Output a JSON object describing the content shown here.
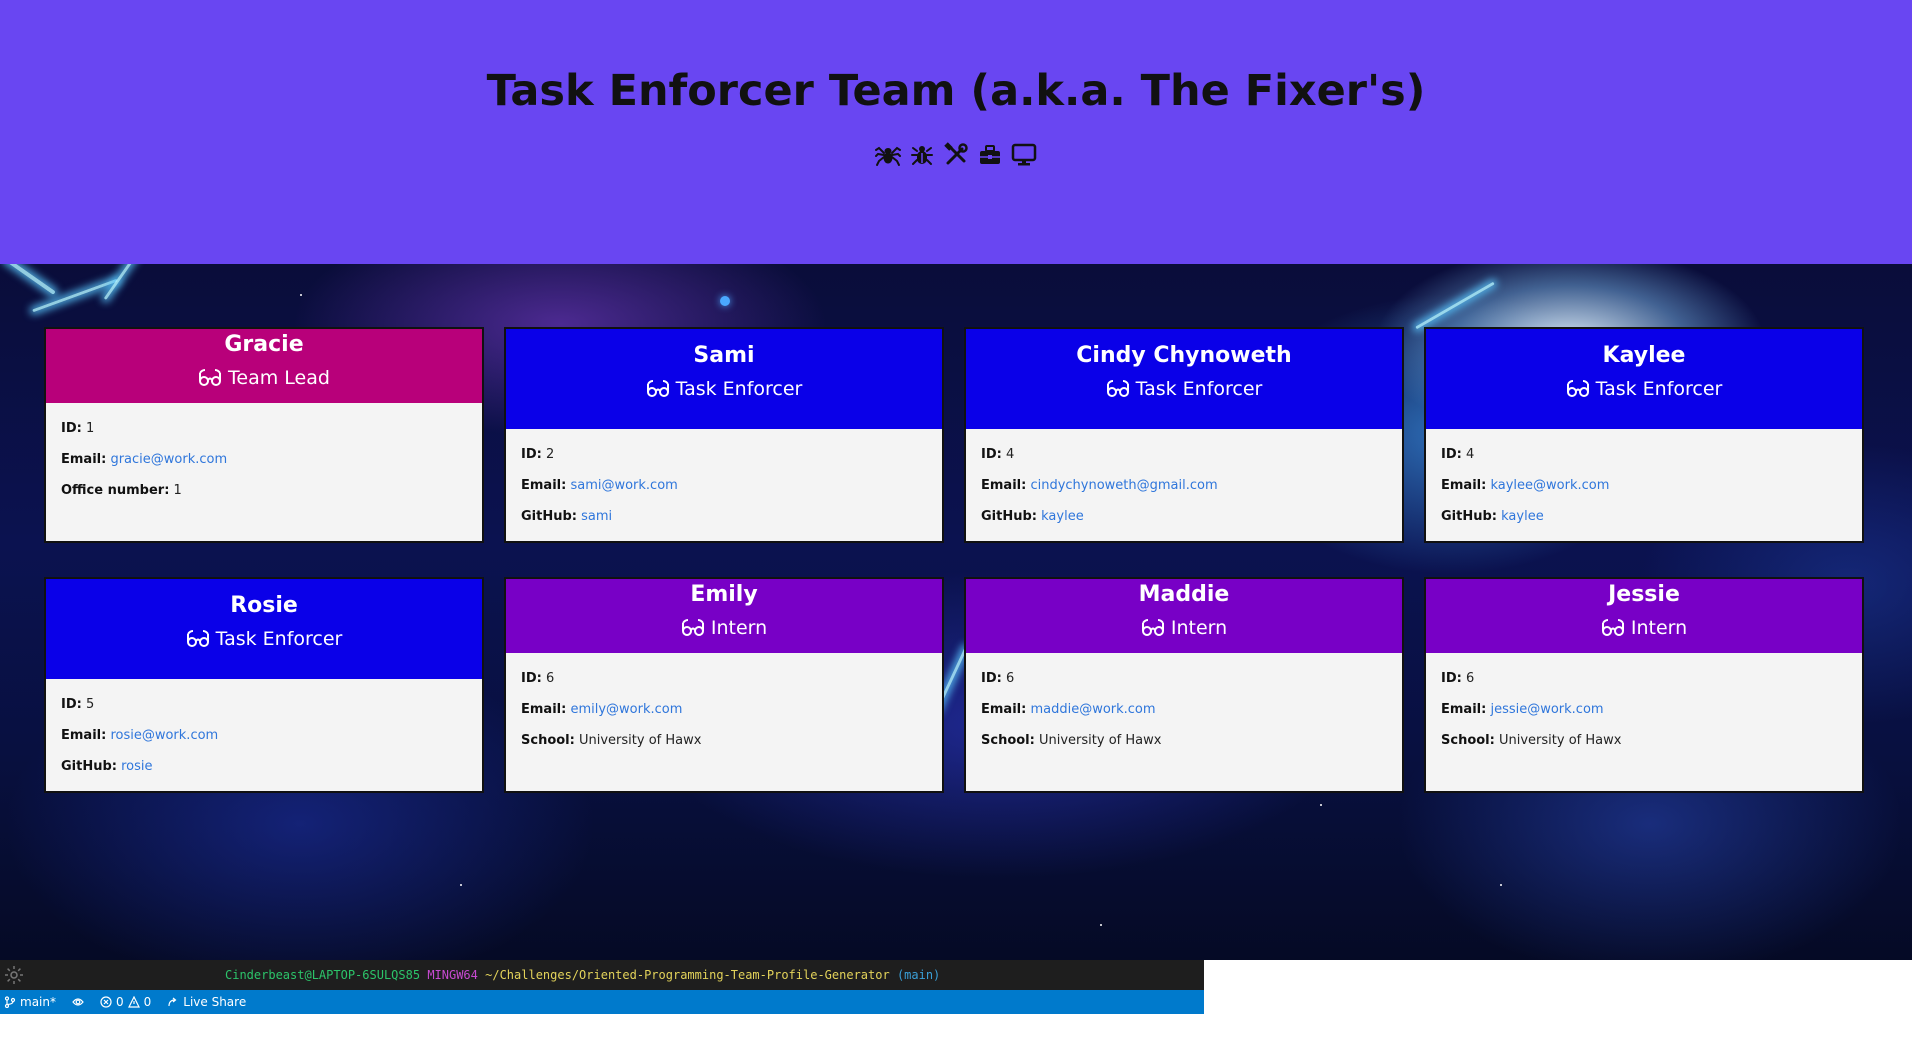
{
  "header": {
    "title": "Task Enforcer Team (a.k.a. The Fixer's)",
    "icons": [
      "spider-icon",
      "bug-icon",
      "tools-icon",
      "toolbox-icon",
      "desktop-icon"
    ]
  },
  "employees": [
    {
      "name": "Gracie",
      "role": "Team Lead",
      "id_label": "ID:",
      "id": "1",
      "email_label": "Email:",
      "email": "gracie@work.com",
      "extra_label": "Office number:",
      "extra": "1"
    },
    {
      "name": "Sami",
      "role": "Task Enforcer",
      "id_label": "ID:",
      "id": "2",
      "email_label": "Email:",
      "email": "sami@work.com",
      "extra_label": "GitHub:",
      "extra": "sami"
    },
    {
      "name": "Cindy Chynoweth",
      "role": "Task Enforcer",
      "id_label": "ID:",
      "id": "4",
      "email_label": "Email:",
      "email": "cindychynoweth@gmail.com",
      "extra_label": "GitHub:",
      "extra": "kaylee"
    },
    {
      "name": "Kaylee",
      "role": "Task Enforcer",
      "id_label": "ID:",
      "id": "4",
      "email_label": "Email:",
      "email": "kaylee@work.com",
      "extra_label": "GitHub:",
      "extra": "kaylee"
    },
    {
      "name": "Rosie",
      "role": "Task Enforcer",
      "id_label": "ID:",
      "id": "5",
      "email_label": "Email:",
      "email": "rosie@work.com",
      "extra_label": "GitHub:",
      "extra": "rosie"
    },
    {
      "name": "Emily",
      "role": "Intern",
      "id_label": "ID:",
      "id": "6",
      "email_label": "Email:",
      "email": "emily@work.com",
      "extra_label": "School:",
      "extra": "University of Hawx"
    },
    {
      "name": "Maddie",
      "role": "Intern",
      "id_label": "ID:",
      "id": "6",
      "email_label": "Email:",
      "email": "maddie@work.com",
      "extra_label": "School:",
      "extra": "University of Hawx"
    },
    {
      "name": "Jessie",
      "role": "Intern",
      "id_label": "ID:",
      "id": "6",
      "email_label": "Email:",
      "email": "jessie@work.com",
      "extra_label": "School:",
      "extra": "University of Hawx"
    }
  ],
  "colors": {
    "header_bg": "#6946f2",
    "lead_header": "#b8007a",
    "enforcer_header": "#0a00e8",
    "intern_header": "#7800c6",
    "link": "#2f76db"
  },
  "terminal": {
    "user": "Cinderbeast@LAPTOP-6SULQS85",
    "system": "MINGW64",
    "path": "~/Challenges/Oriented-Programming-Team-Profile-Generator",
    "branch": "(main)"
  },
  "statusbar": {
    "branch": "main*",
    "errors": "0",
    "warnings": "0",
    "live_share": "Live Share"
  }
}
